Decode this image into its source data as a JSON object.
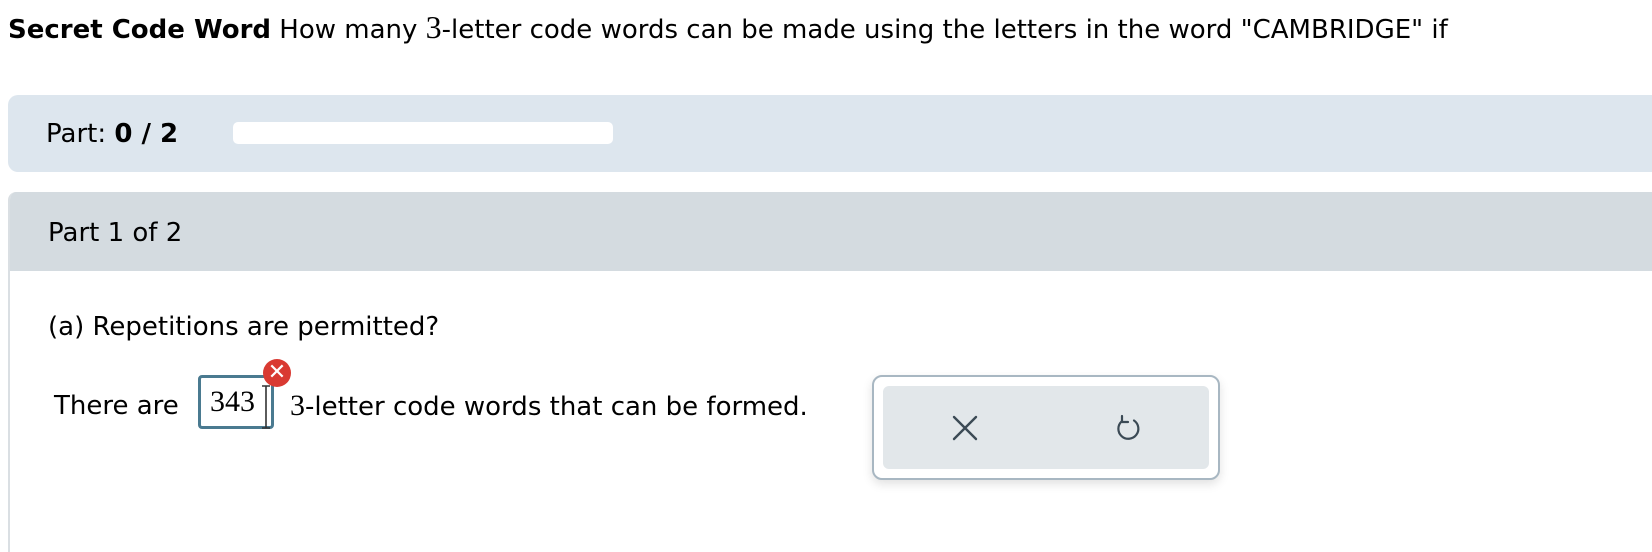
{
  "problem": {
    "title": "Secret Code Word",
    "text_before": "How many ",
    "math_number": "3",
    "text_after": "-letter code words can be made using the letters in the word \"CAMBRIDGE\" if"
  },
  "progress": {
    "label": "Part:",
    "value": "0 / 2",
    "fraction": 0
  },
  "part": {
    "header": "Part 1 of 2",
    "question": "(a) Repetitions are permitted?",
    "answer_prefix": "There are",
    "answer_value": "343",
    "answer_status": "incorrect",
    "answer_suffix_number": "3",
    "answer_suffix_text": "-letter code words that can be formed."
  },
  "actions": {
    "clear_icon": "close-icon",
    "undo_icon": "undo-icon"
  },
  "colors": {
    "progress_panel_bg": "#dde6ee",
    "part_header_bg": "#d4dbe0",
    "error": "#d93a32",
    "input_border": "#4a7a90",
    "action_bg": "#e2e7ea",
    "icon_color": "#3b4a55"
  }
}
